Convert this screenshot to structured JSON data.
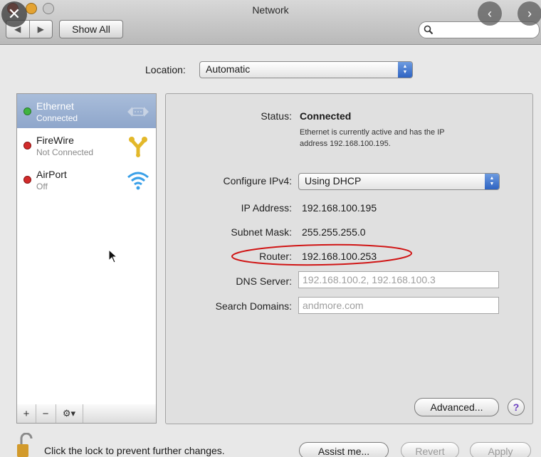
{
  "window": {
    "title": "Network"
  },
  "toolbar": {
    "back": "◀",
    "forward": "▶",
    "show_all": "Show All"
  },
  "location": {
    "label": "Location:",
    "value": "Automatic"
  },
  "services": [
    {
      "name": "Ethernet",
      "status": "Connected",
      "status_color": "#3fb33f",
      "selected": true,
      "icon": "ethernet-icon"
    },
    {
      "name": "FireWire",
      "status": "Not Connected",
      "status_color": "#d22b2b",
      "selected": false,
      "icon": "firewire-icon"
    },
    {
      "name": "AirPort",
      "status": "Off",
      "status_color": "#d22b2b",
      "selected": false,
      "icon": "wifi-icon"
    }
  ],
  "sidebar_tools": {
    "add": "+",
    "remove": "−",
    "action": "⚙▾"
  },
  "detail": {
    "status_label": "Status:",
    "status_value": "Connected",
    "status_desc_1": "Ethernet is currently active and has the IP",
    "status_desc_2": "address 192.168.100.195.",
    "configure_label": "Configure IPv4:",
    "configure_value": "Using DHCP",
    "ip_label": "IP Address:",
    "ip_value": "192.168.100.195",
    "subnet_label": "Subnet Mask:",
    "subnet_value": "255.255.255.0",
    "router_label": "Router:",
    "router_value": "192.168.100.253",
    "dns_label": "DNS Server:",
    "dns_value": "192.168.100.2, 192.168.100.3",
    "search_label": "Search Domains:",
    "search_value": "andmore.com",
    "advanced": "Advanced...",
    "help": "?"
  },
  "footer": {
    "lock_text": "Click the lock to prevent further changes.",
    "assist": "Assist me...",
    "revert": "Revert",
    "apply": "Apply"
  },
  "overlay": {
    "close": "✕",
    "prev": "‹",
    "next": "›"
  },
  "colors": {
    "selection": "#8ea6cb",
    "annotation": "#d01515",
    "popup_accent": "#2e63c2"
  }
}
